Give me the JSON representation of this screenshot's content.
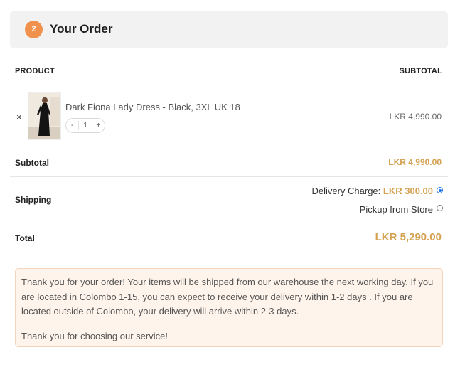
{
  "step": {
    "number": "2",
    "title": "Your Order"
  },
  "table": {
    "col_product": "PRODUCT",
    "col_subtotal": "SUBTOTAL"
  },
  "item": {
    "remove_icon": "×",
    "name": "Dark Fiona Lady Dress - Black, 3XL UK 18",
    "qty_minus": "-",
    "qty_value": "1",
    "qty_plus": "+",
    "price": "LKR 4,990.00"
  },
  "subtotal": {
    "label": "Subtotal",
    "value": "LKR 4,990.00"
  },
  "shipping": {
    "label": "Shipping",
    "delivery_label": "Delivery Charge:",
    "delivery_amount": "LKR 300.00",
    "pickup_label": "Pickup from Store",
    "selected": "delivery"
  },
  "total": {
    "label": "Total",
    "value": "LKR 5,290.00"
  },
  "notice": {
    "paragraph1": "Thank you for your order! Your items will be shipped from our warehouse the next working day. If you are located in Colombo 1-15, you can expect to receive your delivery within 1-2 days . If you are located outside of Colombo, your delivery will arrive within 2-3 days.",
    "paragraph2": "Thank you for choosing our service!"
  },
  "colors": {
    "accent": "#d4a151",
    "badge": "#f0924d",
    "notice_bg": "#fff4ec"
  }
}
